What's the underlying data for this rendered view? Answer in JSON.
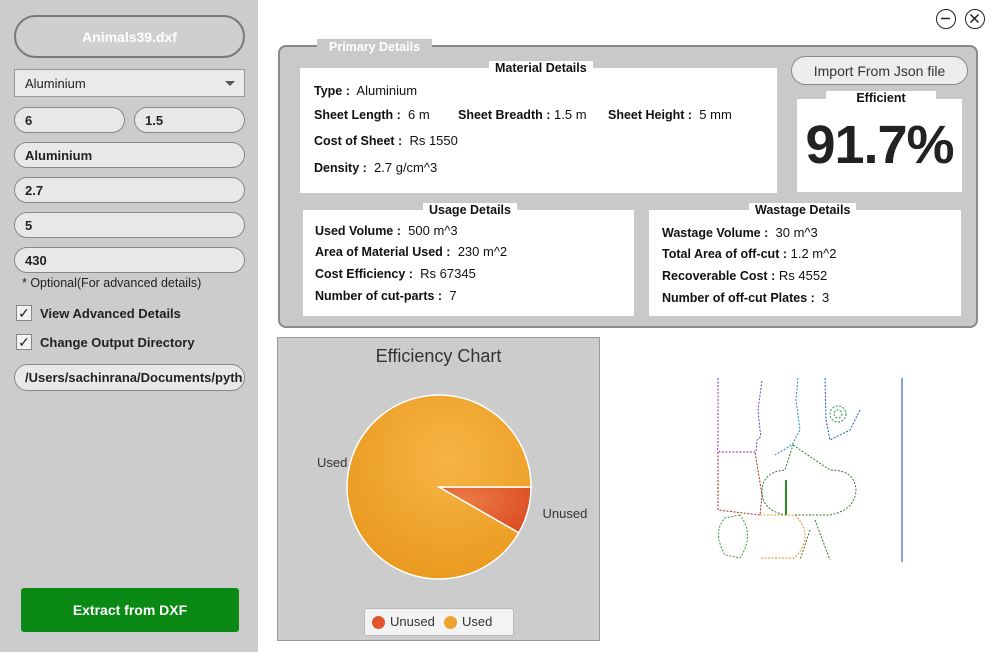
{
  "sidebar": {
    "file_button": "Animals39.dxf",
    "material_select": "Aluminium",
    "length_value": "6",
    "breadth_value": "1.5",
    "material_name": "Aluminium",
    "density_value": "2.7",
    "height_value": "5",
    "cost_value": "430",
    "optional_note": "* Optional(For advanced details)",
    "view_advanced_label": "View Advanced Details",
    "change_output_label": "Change Output Directory",
    "output_path": "/Users/sachinrana/Documents/pyth",
    "extract_button": "Extract from DXF"
  },
  "primary": {
    "title": "Primary Details",
    "material": {
      "title": "Material Details",
      "type_label": "Type :",
      "type_value": "Aluminium",
      "sheet_length_label": "Sheet Length :",
      "sheet_length_value": "6 m",
      "sheet_breadth_label": "Sheet Breadth :",
      "sheet_breadth_value": "1.5 m",
      "sheet_height_label": "Sheet Height :",
      "sheet_height_value": "5 mm",
      "cost_label": "Cost of Sheet :",
      "cost_value": "Rs 1550",
      "density_label": "Density :",
      "density_value": "2.7 g/cm^3"
    },
    "usage": {
      "title": "Usage Details",
      "used_volume_label": "Used Volume :",
      "used_volume_value": "500 m^3",
      "area_used_label": "Area of Material Used :",
      "area_used_value": "230 m^2",
      "cost_eff_label": "Cost Efficiency :",
      "cost_eff_value": "Rs 67345",
      "cut_parts_label": "Number of cut-parts :",
      "cut_parts_value": "7"
    },
    "wastage": {
      "title": "Wastage Details",
      "wastage_volume_label": "Wastage Volume :",
      "wastage_volume_value": "30 m^3",
      "offcut_area_label": "Total Area of off-cut :",
      "offcut_area_value": "1.2 m^2",
      "recoverable_label": "Recoverable Cost :",
      "recoverable_value": "Rs 4552",
      "offcut_plates_label": "Number of off-cut Plates :",
      "offcut_plates_value": "3"
    },
    "import_button": "Import From Json file",
    "efficiency_title": "Efficient",
    "efficiency_value": "91.7%"
  },
  "chart_data": {
    "type": "pie",
    "title": "Efficiency Chart",
    "categories": [
      "Unused",
      "Used"
    ],
    "values": [
      8.3,
      91.7
    ],
    "colors": [
      "#e0552a",
      "#f0a22e"
    ],
    "legend": "bottom"
  },
  "colors": {
    "sidebar_bg": "#cccccc",
    "extract_button": "#0a8a14",
    "panel_bg": "#c9c9c9"
  },
  "icons": {
    "minimize": "minus-circle-icon",
    "close": "x-circle-icon",
    "check": "checkmark-icon"
  }
}
